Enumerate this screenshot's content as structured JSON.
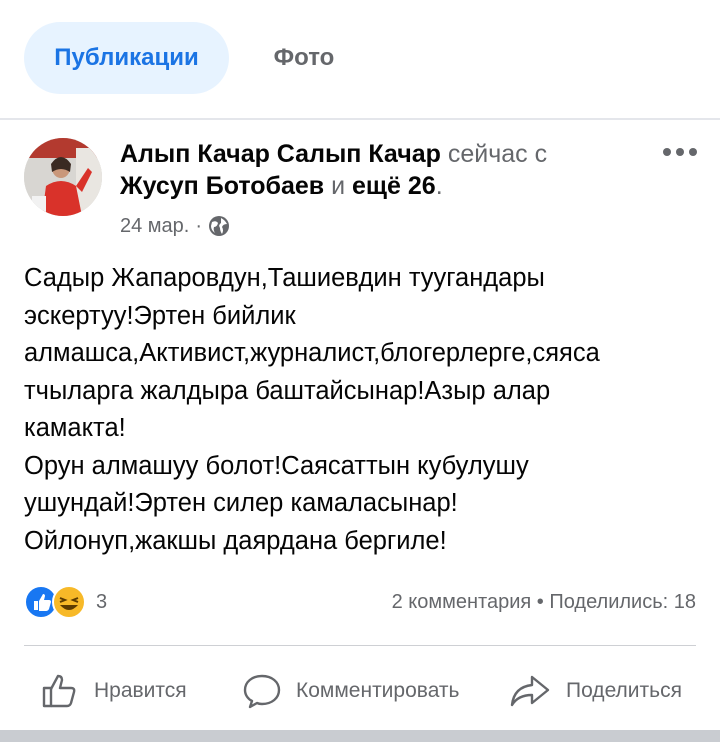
{
  "tabs": {
    "active_label": "Публикации",
    "photo_label": "Фото"
  },
  "post": {
    "author": "Алып Качар Салып Качар",
    "with_text": "сейчас с",
    "tagged": "Жусуп Ботобаев",
    "and_text": "и",
    "others": "ещё 26",
    "period": ".",
    "date": "24 мар.",
    "meta_dot": "·",
    "privacy_icon": "globe-icon",
    "body": "Садыр Жапаровдун,Ташиевдин туугандары\nэскертуу!Эртен бийлик\nалмашса,Активист,журналист,блогерлерге,сяяса\nтчыларга жалдыра баштайсынар!Азыр алар\nкамакта!\nОрун алмашуу болот!Саясаттын кубулушу\nушундай!Эртен силер камаласынар!\nОйлонуп,жакшы даярдана бергиле!"
  },
  "engagement": {
    "reaction_count": "3",
    "comments": "2 комментария",
    "separator": "•",
    "shares": "Поделились: 18"
  },
  "actions": {
    "like": "Нравится",
    "comment": "Комментировать",
    "share": "Поделиться"
  },
  "colors": {
    "accent": "#1b74e4",
    "muted": "#65676b",
    "like_blue": "#1877f2",
    "haha_yellow": "#f7b928"
  }
}
